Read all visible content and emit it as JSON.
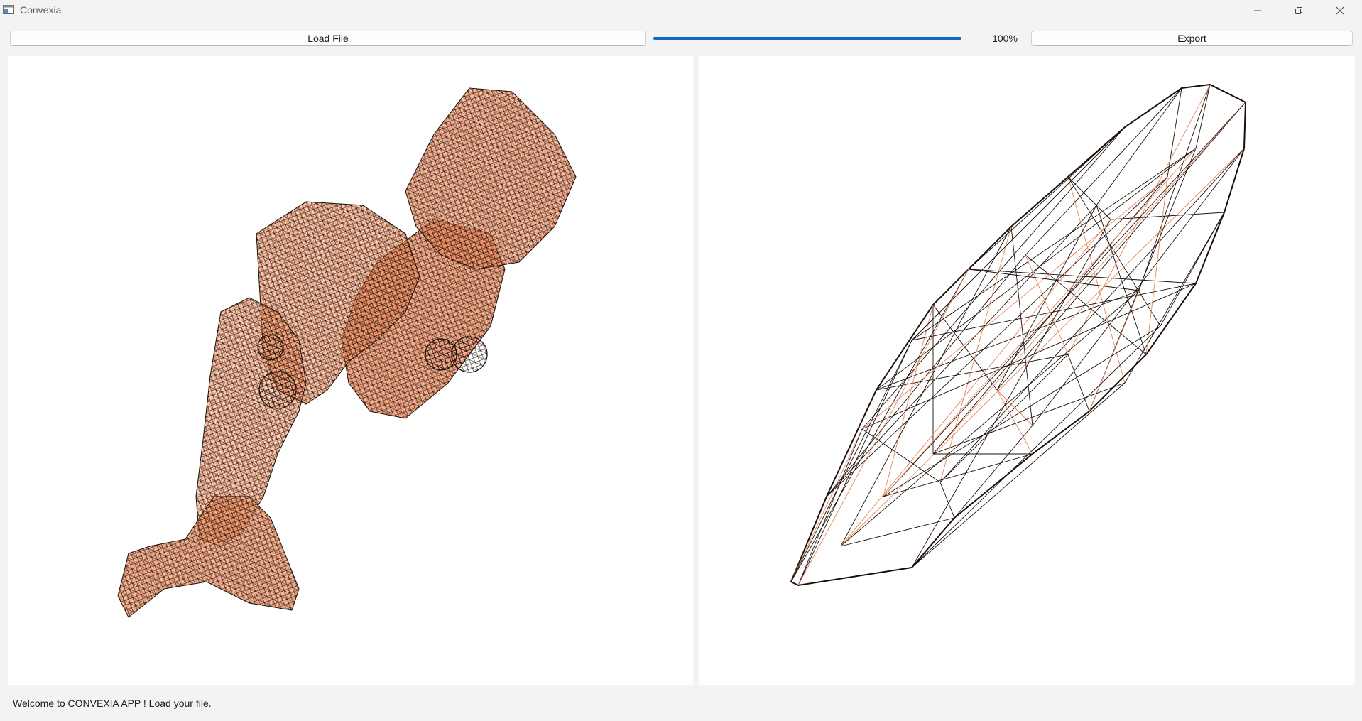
{
  "window": {
    "title": "Convexia",
    "icon": "app-window-icon"
  },
  "title_buttons": {
    "minimize_icon": "minimize-icon",
    "maximize_icon": "restore-icon",
    "close_icon": "close-icon"
  },
  "toolbar": {
    "load_label": "Load File",
    "progress": 1.0,
    "progress_text": "100%",
    "export_label": "Export"
  },
  "viewports": {
    "left_content": "wireframe mesh of loaded 3D model",
    "right_content": "wireframe of computed convex hull",
    "mesh_color": "#e8865a",
    "line_color": "#1a0e08"
  },
  "colors": {
    "accent": "#0f6cbd",
    "background": "#f3f3f3",
    "viewport_bg": "#ffffff"
  },
  "status": {
    "message": "Welcome to CONVEXIA APP ! Load your file."
  }
}
